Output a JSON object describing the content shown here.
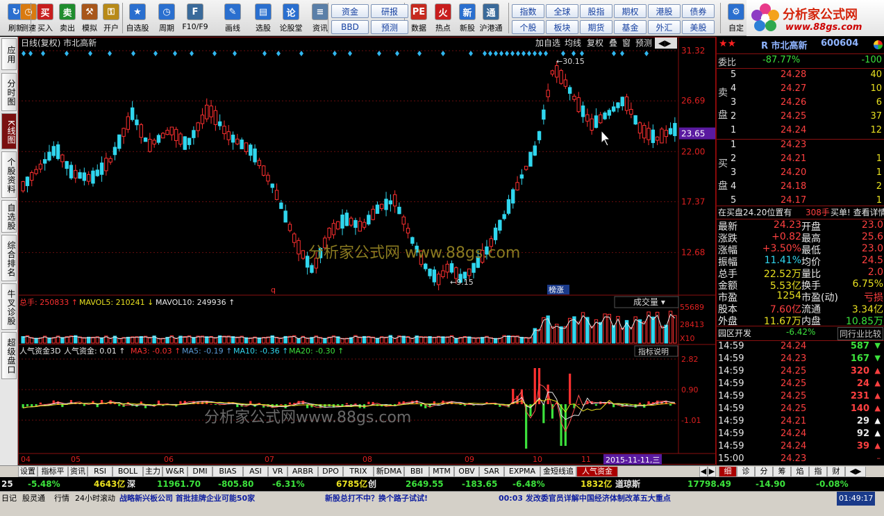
{
  "toolbar": {
    "buttons": [
      {
        "label": "刷新",
        "icon": "refresh-icon"
      },
      {
        "label": "测速",
        "icon": "clock-icon"
      },
      {
        "label": "买入",
        "icon": "buy-icon"
      },
      {
        "label": "卖出",
        "icon": "sell-icon"
      },
      {
        "label": "模拟",
        "icon": "gavel-icon"
      },
      {
        "label": "开户",
        "icon": "lock-icon"
      },
      {
        "label": "自选股",
        "icon": "star-icon"
      },
      {
        "label": "周期",
        "icon": "period-clock-icon"
      },
      {
        "label": "F10/F9",
        "icon": "f10-icon"
      },
      {
        "label": "画线",
        "icon": "pencil-icon"
      },
      {
        "label": "选股",
        "icon": "screen-icon"
      },
      {
        "label": "论股堂",
        "icon": "forum-icon"
      },
      {
        "label": "资讯",
        "icon": "news-icon"
      },
      {
        "label": "数据",
        "icon": "pe-icon"
      },
      {
        "label": "热点",
        "icon": "hot-icon"
      },
      {
        "label": "新股",
        "icon": "new-stock-icon"
      },
      {
        "label": "沪港通",
        "icon": "shhk-icon"
      },
      {
        "label": "自定",
        "icon": "custom-icon"
      }
    ],
    "pills_a": [
      [
        "资金",
        "研报"
      ],
      [
        "BBD",
        "预测"
      ]
    ],
    "pills_b": [
      [
        "指数",
        "全球",
        "股指",
        "期权",
        "港股",
        "债券"
      ],
      [
        "个股",
        "板块",
        "期货",
        "基金",
        "外汇",
        "美股"
      ]
    ]
  },
  "brand": {
    "title": "分析家公式网",
    "url": "www.88gs.com"
  },
  "left_tabs": [
    "应用",
    "分时图",
    "K线图",
    "个股资料",
    "自选股",
    "综合排名",
    "牛叉诊股",
    "超级盘口"
  ],
  "chart": {
    "header_left": "日线(复权)  市北高新",
    "header_buttons": [
      "加自选",
      "均线",
      "复权",
      "叠",
      "窗",
      "预测"
    ],
    "price_axis": [
      "31.32",
      "26.69",
      "22.00",
      "17.37",
      "12.68"
    ],
    "current_price_tag": "23.65",
    "high_label": "30.15",
    "low_label": "9.15",
    "marker_q": "q",
    "marker_bang": "榜涨",
    "watermark": "分析家公式网 www.88gs.com",
    "watermark2": "分析家公式网www.88gs.com",
    "volume": {
      "label_total": "总手: 250833",
      "label_mavol5": "MAVOL5: 210241",
      "label_mavol10": "MAVOL10: 249936",
      "axis": [
        "55689",
        "28413",
        "X10"
      ],
      "dropdown": "成交量"
    },
    "indicator": {
      "name": "人气资金3D",
      "value": "人气资金: 0.01",
      "ma3": "MA3: -0.03",
      "ma5": "MA5: -0.19",
      "ma10": "MA10: -0.36",
      "ma20": "MA20: -0.30",
      "explain": "指标说明",
      "axis": [
        "2.82",
        "0.90",
        "-1.01"
      ]
    },
    "months": [
      "04",
      "05",
      "06",
      "07",
      "08",
      "09",
      "10",
      "11"
    ],
    "date_tag": "2015-11-11,三"
  },
  "quote": {
    "name": "R 市北高新",
    "code": "600604",
    "weibi_label": "委比",
    "weibi": "-87.77%",
    "weicha": "-100",
    "sell_label": [
      "卖",
      "盘"
    ],
    "buy_label": [
      "买",
      "盘"
    ],
    "sells": [
      {
        "n": "5",
        "p": "24.28",
        "v": "40"
      },
      {
        "n": "4",
        "p": "24.27",
        "v": "10"
      },
      {
        "n": "3",
        "p": "24.26",
        "v": "6"
      },
      {
        "n": "2",
        "p": "24.25",
        "v": "37"
      },
      {
        "n": "1",
        "p": "24.24",
        "v": "12"
      }
    ],
    "buys": [
      {
        "n": "1",
        "p": "24.23",
        "v": ""
      },
      {
        "n": "2",
        "p": "24.21",
        "v": "1"
      },
      {
        "n": "3",
        "p": "24.20",
        "v": "1"
      },
      {
        "n": "4",
        "p": "24.18",
        "v": "2"
      },
      {
        "n": "5",
        "p": "24.17",
        "v": "1"
      }
    ],
    "notice": "在买盘24.20位置有",
    "notice_vol": "308手",
    "notice_tail": "买单! 查看详情",
    "stats": [
      {
        "l": "最新",
        "v": "24.23",
        "l2": "开盘",
        "v2": "23.0"
      },
      {
        "l": "涨跌",
        "v": "+0.82",
        "l2": "最高",
        "v2": "25.6"
      },
      {
        "l": "涨幅",
        "v": "+3.50%",
        "l2": "最低",
        "v2": "23.0"
      },
      {
        "l": "振幅",
        "v": "11.41%",
        "l2": "均价",
        "v2": "24.5"
      },
      {
        "l": "总手",
        "v": "22.52万",
        "l2": "量比",
        "v2": "2.0"
      },
      {
        "l": "金额",
        "v": "5.53亿",
        "l2": "换手",
        "v2": "6.75%"
      },
      {
        "l": "市盈",
        "v": "1254",
        "l2": "市盈(动)",
        "v2": "亏损"
      },
      {
        "l": "股本",
        "v": "7.60亿",
        "l2": "流通",
        "v2": "3.34亿"
      },
      {
        "l": "外盘",
        "v": "11.67万",
        "l2": "内盘",
        "v2": "10.85万"
      }
    ],
    "sector": "园区开发",
    "sector_pct": "-6.42%",
    "sector_btn": "同行业比较",
    "ticks": [
      {
        "t": "14:59",
        "p": "24.24",
        "v": "587",
        "d": "down"
      },
      {
        "t": "14:59",
        "p": "24.23",
        "v": "167",
        "d": "down"
      },
      {
        "t": "14:59",
        "p": "24.25",
        "v": "320",
        "d": "up"
      },
      {
        "t": "14:59",
        "p": "24.25",
        "v": "24",
        "d": "up"
      },
      {
        "t": "14:59",
        "p": "24.25",
        "v": "231",
        "d": "up"
      },
      {
        "t": "14:59",
        "p": "24.25",
        "v": "140",
        "d": "up"
      },
      {
        "t": "14:59",
        "p": "24.21",
        "v": "29",
        "d": "up-white"
      },
      {
        "t": "14:59",
        "p": "24.24",
        "v": "92",
        "d": "up-white"
      },
      {
        "t": "14:59",
        "p": "24.24",
        "v": "39",
        "d": "up"
      },
      {
        "t": "15:00",
        "p": "24.23",
        "v": "",
        "d": "dash"
      }
    ],
    "bottom_tabs": [
      "细",
      "诊",
      "分",
      "筹",
      "焰",
      "指",
      "财"
    ]
  },
  "bottom_tabs": [
    "设置",
    "指标平台",
    "资讯",
    "RSI",
    "BOLL",
    "主力",
    "W&R",
    "DMI",
    "BIAS",
    "ASI",
    "VR",
    "ARBR",
    "DPO",
    "TRIX",
    "新DMA",
    "BBI",
    "MTM",
    "OBV",
    "SAR",
    "EXPMA",
    "金短线追踪",
    "人气资金3D"
  ],
  "index_bar": [
    {
      "t": "25",
      "c": "white"
    },
    {
      "t": "-5.48%",
      "c": "green"
    },
    {
      "t": "4643亿",
      "c": "yellow"
    },
    {
      "t": "深",
      "c": "white"
    },
    {
      "t": "11961.70",
      "c": "green"
    },
    {
      "t": "-805.80",
      "c": "green"
    },
    {
      "t": "-6.31%",
      "c": "green"
    },
    {
      "t": "6785亿",
      "c": "yellow"
    },
    {
      "t": "创",
      "c": "white"
    },
    {
      "t": "2649.55",
      "c": "green"
    },
    {
      "t": "-183.65",
      "c": "green"
    },
    {
      "t": "-6.48%",
      "c": "green"
    },
    {
      "t": "1832亿",
      "c": "yellow"
    },
    {
      "t": "道琼斯",
      "c": "white"
    },
    {
      "t": "17798.49",
      "c": "green"
    },
    {
      "t": "-14.90",
      "c": "green"
    },
    {
      "t": "-0.08%",
      "c": "green"
    }
  ],
  "news_bar": {
    "items": [
      "日记",
      "股灵通",
      "行情",
      "24小时滚动"
    ],
    "news1": "战略新兴板公司 首批挂牌企业可能50家",
    "news2": "新股总打不中？换个路子试试!",
    "news3": "00:03 发改委官员详解中国经济体制改革五大重点",
    "time": "01:49:17"
  }
}
